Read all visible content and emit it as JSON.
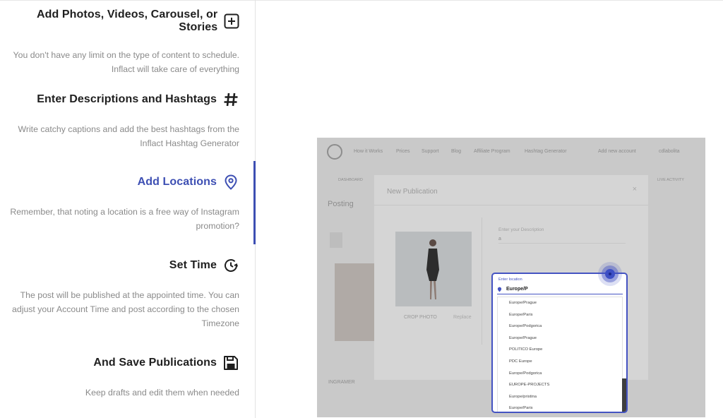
{
  "features": [
    {
      "title": "Add Photos, Videos, Carousel, or Stories",
      "icon": "plus-square-icon",
      "desc": "You don't have any limit on the type of content to schedule. Inflact will take care of everything"
    },
    {
      "title": "Enter Descriptions and Hashtags",
      "icon": "hashtag-icon",
      "desc": "Write catchy captions and add the best hashtags from the Inflact Hashtag Generator"
    },
    {
      "title": "Add Locations",
      "icon": "location-pin-icon",
      "desc": "Remember, that noting a location is a free way of Instagram promotion?",
      "active": true
    },
    {
      "title": "Set Time",
      "icon": "clock-arrow-icon",
      "desc": "The post will be published at the appointed time. You can adjust your Account Time and post according to the chosen Timezone"
    },
    {
      "title": "And Save Publications",
      "icon": "floppy-disk-icon",
      "desc": "Keep drafts and edit them when needed"
    }
  ],
  "accent_color": "#3d4fb3",
  "screenshot": {
    "nav_links": [
      "How it Works",
      "Prices",
      "Support",
      "Blog",
      "Affiliate Program",
      "Hashtag Generator"
    ],
    "account_label": "Add new account",
    "user_label": "cdlabolita",
    "dashboard_label": "DASHBOARD",
    "activity_label": "LIVE ACTIVITY",
    "page_title": "Posting",
    "footer_brand": "INGRAMER",
    "modal": {
      "title": "New Publication",
      "close": "×",
      "crop": "CROP PHOTO",
      "replace": "Replace",
      "description_label": "Enter your Description",
      "description_value": "a"
    },
    "location": {
      "label": "Enter location",
      "value": "Europe/P",
      "options": [
        "Europe/Prague",
        "Europe/Paris",
        "Europe/Podgorica",
        "Europe/Prague",
        "POLITICO Europe",
        "PDC Europe",
        "Europe/Podgorica",
        "EUROPE-PROJECTS",
        "Europe/pristina",
        "Europe/Paris"
      ]
    }
  }
}
